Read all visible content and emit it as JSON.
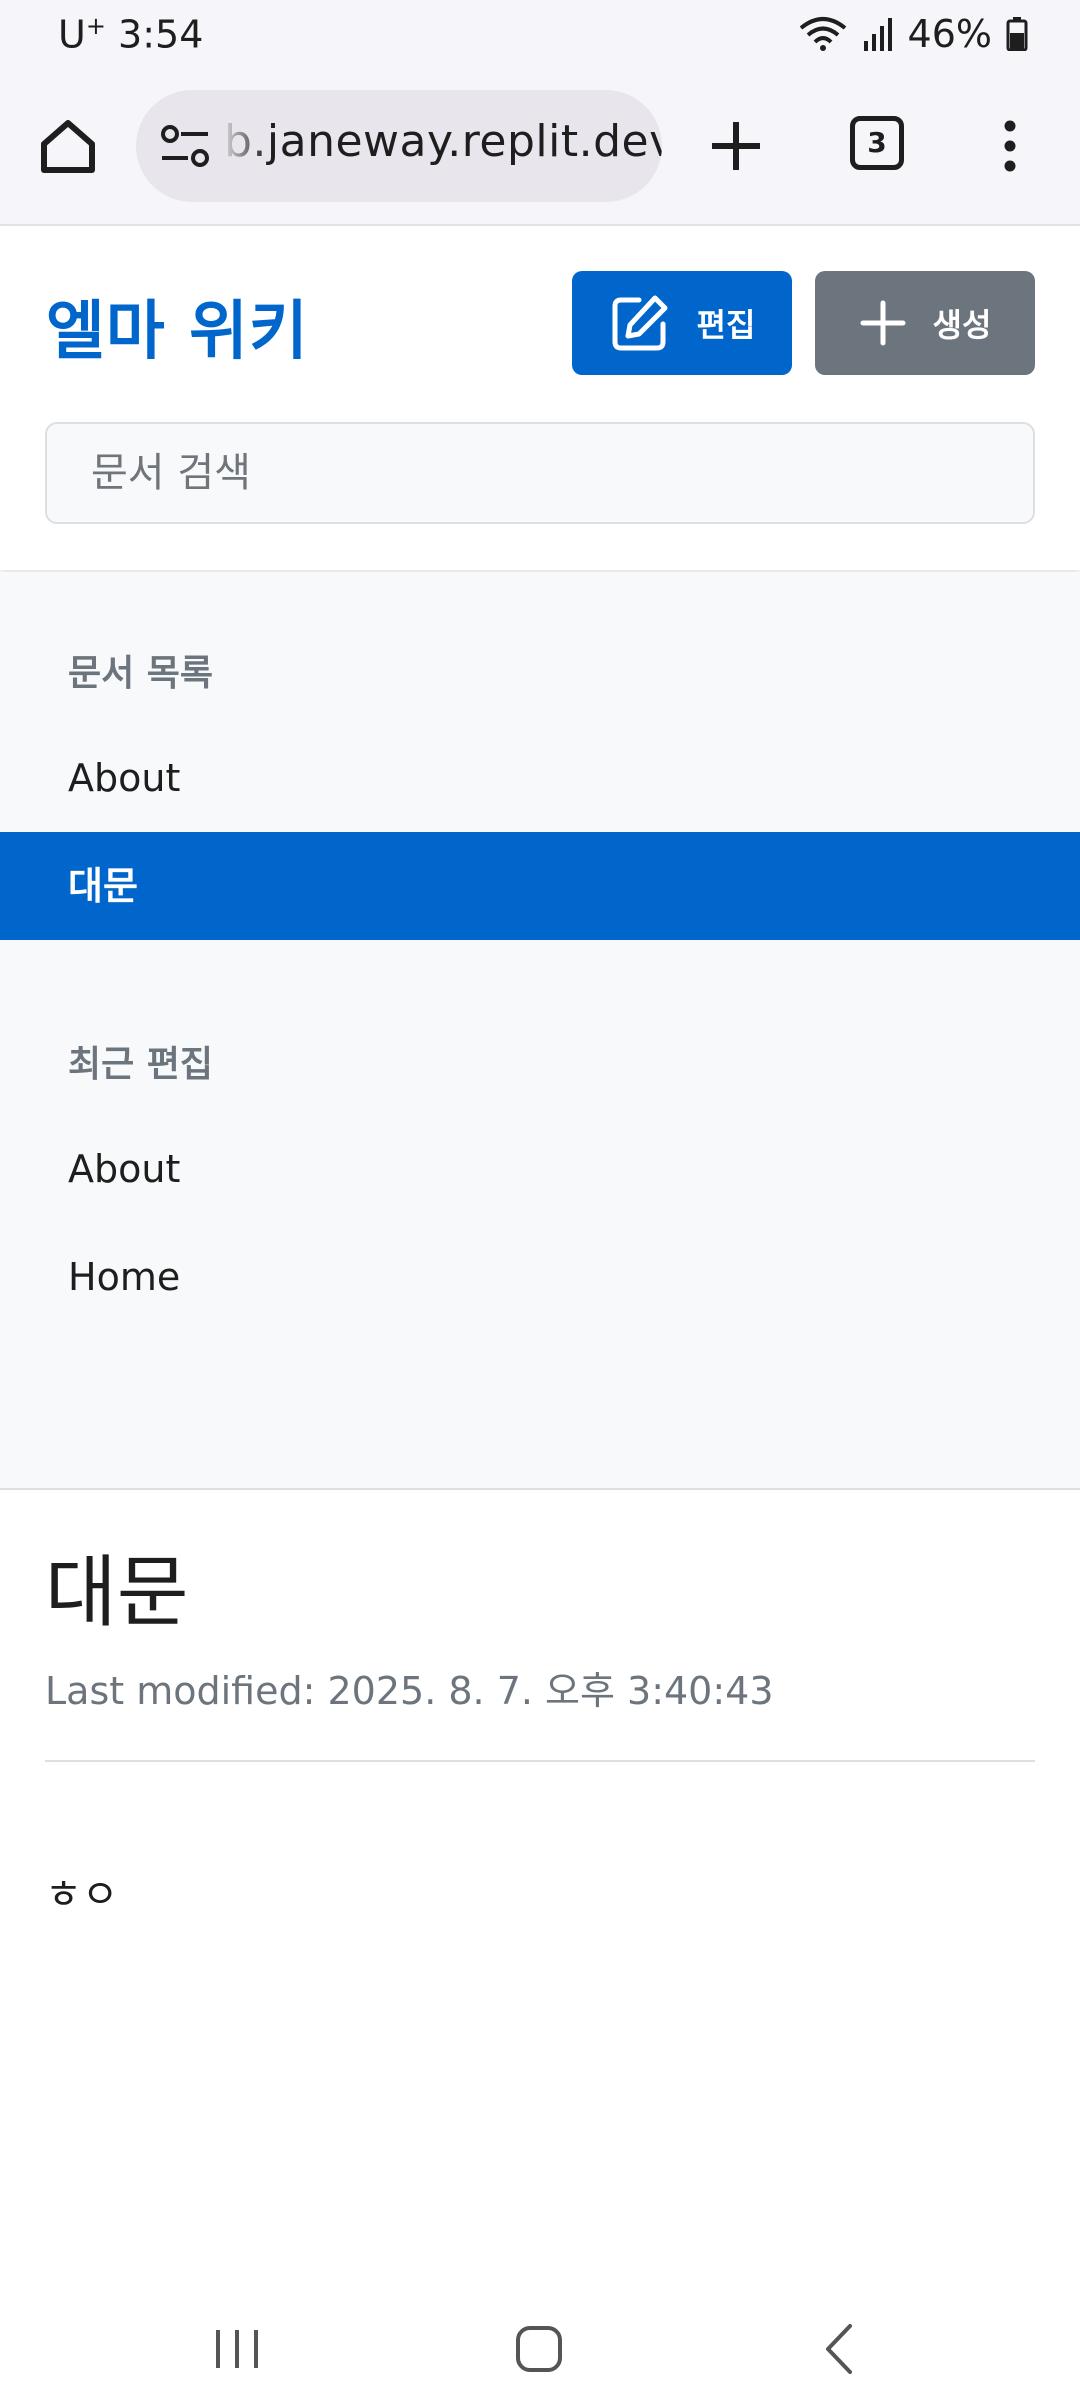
{
  "status": {
    "carrier": "U",
    "carrier_sup": "+",
    "time": "3:54",
    "battery": "46%"
  },
  "browser": {
    "url": "b.janeway.replit.dev",
    "tab_count": "3"
  },
  "header": {
    "title": "엘마 위키",
    "edit_label": "편집",
    "create_label": "생성",
    "search_placeholder": "문서 검색"
  },
  "sidebar": {
    "doc_list_heading": "문서 목록",
    "doc_list": [
      {
        "label": "About"
      },
      {
        "label": "대문"
      }
    ],
    "recent_heading": "최근 편집",
    "recent": [
      {
        "label": "About"
      },
      {
        "label": "Home"
      }
    ]
  },
  "page": {
    "title": "대문",
    "last_modified": "Last modified: 2025. 8. 7. 오후 3:40:43",
    "body": "ㅎㅇ"
  },
  "colors": {
    "accent": "#0066cc",
    "secondary": "#6c757d",
    "sidebar_bg": "#f8f9fa"
  },
  "icons": {
    "home": "home-icon",
    "site_settings": "site-settings-icon",
    "new_tab": "plus-icon",
    "menu": "more-vert-icon",
    "edit": "edit-icon",
    "create": "plus-icon",
    "nav_recent": "recent-apps-icon",
    "nav_home": "home-button-icon",
    "nav_back": "back-icon"
  }
}
